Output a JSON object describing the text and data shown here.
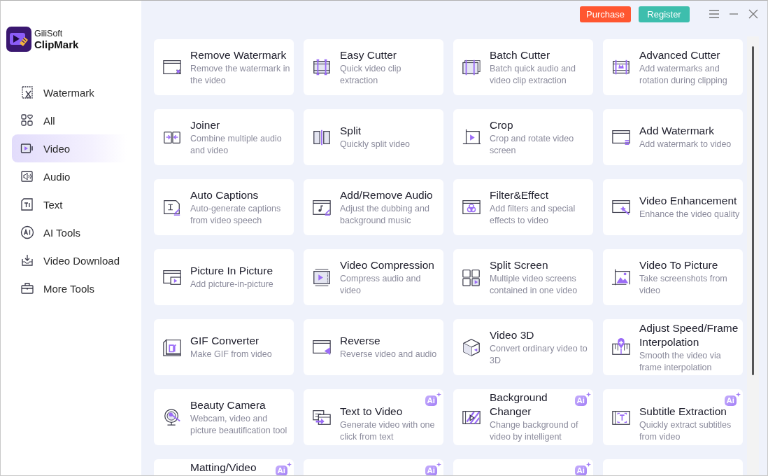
{
  "app": {
    "brand": "GiliSoft",
    "name": "ClipMark"
  },
  "sidebar": {
    "items": [
      {
        "label": "Watermark",
        "selected": false
      },
      {
        "label": "All",
        "selected": false
      },
      {
        "label": "Video",
        "selected": true
      },
      {
        "label": "Audio",
        "selected": false
      },
      {
        "label": "Text",
        "selected": false
      },
      {
        "label": "AI Tools",
        "selected": false
      },
      {
        "label": "Video Download",
        "selected": false
      },
      {
        "label": "More Tools",
        "selected": false
      }
    ]
  },
  "top_bar": {
    "buttons": [
      {
        "label": "Purchase",
        "kind": "purchase"
      },
      {
        "label": "Register",
        "kind": "register"
      }
    ]
  },
  "tools": [
    {
      "kind": "tool",
      "title": "Remove Watermark",
      "description": "Remove the watermark in the video"
    },
    {
      "kind": "tool",
      "title": "Easy Cutter",
      "description": "Quick video clip extraction"
    },
    {
      "kind": "tool",
      "title": "Batch Cutter",
      "description": "Batch quick audio and video clip extraction"
    },
    {
      "kind": "tool",
      "title": "Advanced Cutter",
      "description": "Add watermarks and rotation during clipping"
    },
    {
      "kind": "tool",
      "title": "Joiner",
      "description": "Combine multiple audio and video"
    },
    {
      "kind": "tool",
      "title": "Split",
      "description": "Quickly split video"
    },
    {
      "kind": "tool",
      "title": "Crop",
      "description": "Crop and rotate video screen"
    },
    {
      "kind": "tool",
      "title": "Add Watermark",
      "description": "Add watermark to video"
    },
    {
      "kind": "tool",
      "title": "Auto Captions",
      "description": "Auto-generate captions from video speech"
    },
    {
      "kind": "tool",
      "title": "Add/Remove Audio",
      "description": "Adjust the dubbing and background music"
    },
    {
      "kind": "tool",
      "title": "Filter&Effect",
      "description": "Add filters and special effects to video"
    },
    {
      "kind": "tool",
      "title": "Video Enhancement",
      "description": "Enhance the video quality"
    },
    {
      "kind": "tool",
      "title": "Picture In Picture",
      "description": "Add picture-in-picture"
    },
    {
      "kind": "tool",
      "title": "Video Compression",
      "description": "Compress audio and video"
    },
    {
      "kind": "tool",
      "title": "Split Screen",
      "description": "Multiple video screens contained in one video"
    },
    {
      "kind": "tool",
      "title": "Video To Picture",
      "description": "Take screenshots from video"
    },
    {
      "kind": "tool",
      "title": "GIF Converter",
      "description": "Make GIF from video"
    },
    {
      "kind": "tool",
      "title": "Reverse",
      "description": "Reverse video and audio"
    },
    {
      "kind": "tool",
      "title": "Video 3D",
      "description": "Convert ordinary video to 3D"
    },
    {
      "kind": "tool",
      "title": "Adjust Speed/Frame Interpolation",
      "description": "Smooth the video via frame interpolation"
    },
    {
      "kind": "tool",
      "title": "Beauty Camera",
      "description": "Webcam, video and picture beautification tool"
    },
    {
      "kind": "tool",
      "title": "Text to Video",
      "description": "Generate video with one click from text",
      "badge": "Ai"
    },
    {
      "kind": "tool",
      "title": "Background Changer",
      "description": "Change background of video by intelligent",
      "badge": "Ai"
    },
    {
      "kind": "tool",
      "title": "Subtitle Extraction",
      "description": "Quickly extract subtitles from video",
      "badge": "Ai"
    },
    {
      "kind": "tool",
      "title": "Matting/Video",
      "badge": "Ai"
    },
    {
      "kind": "tool",
      "badge": "Ai"
    },
    {
      "kind": "tool",
      "badge": "Ai"
    },
    {
      "kind": "blank"
    }
  ]
}
